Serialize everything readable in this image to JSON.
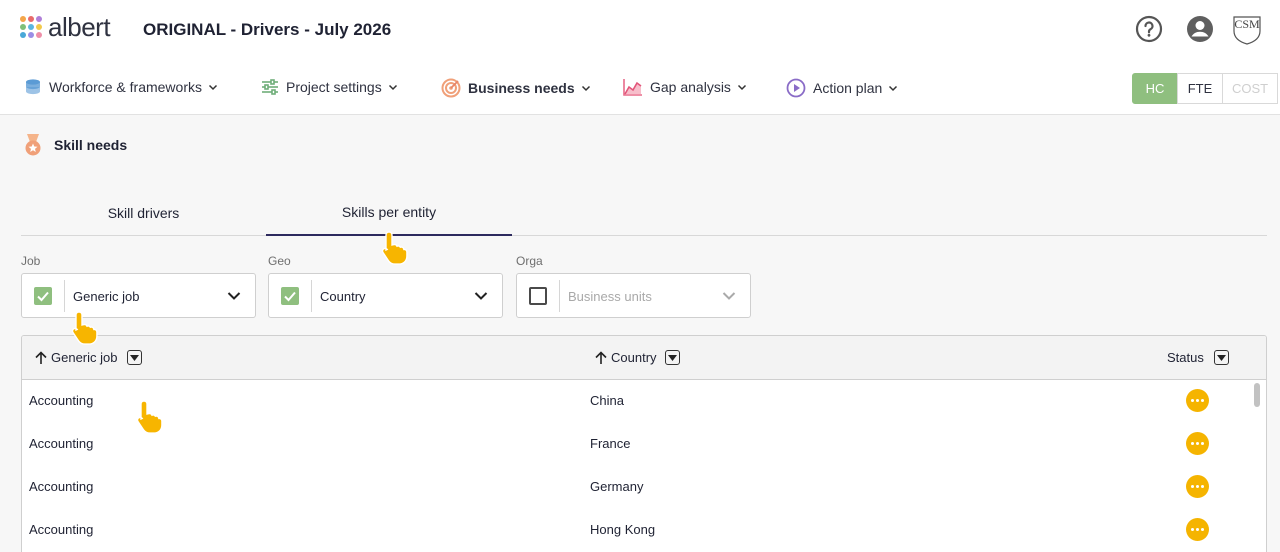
{
  "header": {
    "logo_text": "albert",
    "project_title": "ORIGINAL - Drivers - July 2026",
    "icons": [
      "help-icon",
      "account-icon",
      "csm-logo"
    ],
    "brand_logo_text": "CSM"
  },
  "nav": {
    "items": [
      {
        "label": "Workforce & frameworks",
        "icon": "database-icon",
        "active": false
      },
      {
        "label": "Project settings",
        "icon": "sliders-icon",
        "active": false
      },
      {
        "label": "Business needs",
        "icon": "target-icon",
        "active": true
      },
      {
        "label": "Gap analysis",
        "icon": "area-chart-icon",
        "active": false
      },
      {
        "label": "Action plan",
        "icon": "play-circle-icon",
        "active": false
      }
    ],
    "unit_toggle": {
      "options": [
        "HC",
        "FTE",
        "COST"
      ],
      "selected": "HC"
    }
  },
  "section": {
    "title": "Skill needs",
    "icon": "medal-icon"
  },
  "tabs": [
    {
      "label": "Skill drivers",
      "active": false
    },
    {
      "label": "Skills per entity",
      "active": true
    }
  ],
  "filters": [
    {
      "label": "Job",
      "value": "Generic job",
      "checked": true,
      "disabled": false
    },
    {
      "label": "Geo",
      "value": "Country",
      "checked": true,
      "disabled": false
    },
    {
      "label": "Orga",
      "value": "Business units",
      "checked": false,
      "disabled": true
    }
  ],
  "table": {
    "columns": [
      "Generic job",
      "Country",
      "Status"
    ],
    "rows": [
      {
        "job": "Accounting",
        "country": "China",
        "status": "pending"
      },
      {
        "job": "Accounting",
        "country": "France",
        "status": "pending"
      },
      {
        "job": "Accounting",
        "country": "Germany",
        "status": "pending"
      },
      {
        "job": "Accounting",
        "country": "Hong Kong",
        "status": "pending"
      }
    ]
  },
  "colors": {
    "accent_green": "#8fbf7f",
    "status_pending": "#f5b400",
    "tab_underline": "#2d2a5e",
    "pointer": "#f7b500"
  }
}
